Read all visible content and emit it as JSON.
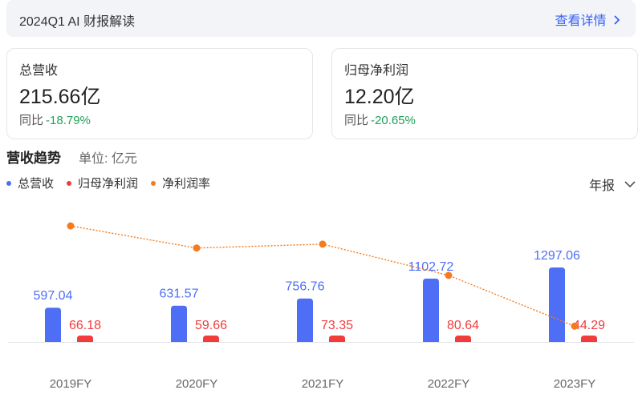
{
  "header": {
    "title": "2024Q1 AI 财报解读",
    "more_label": "查看详情",
    "more_icon": "chevron-right-icon"
  },
  "cards": [
    {
      "label": "总营收",
      "value": "215.66亿",
      "yoy_label": "同比",
      "yoy_value": "-18.79%"
    },
    {
      "label": "归母净利润",
      "value": "12.20亿",
      "yoy_label": "同比",
      "yoy_value": "-20.65%"
    }
  ],
  "section": {
    "title": "营收趋势",
    "unit": "单位: 亿元"
  },
  "period_select": {
    "value": "年报",
    "icon": "chevron-down-icon"
  },
  "colors": {
    "revenue": "#4d6ef5",
    "net_profit": "#f23b3b",
    "margin": "#f47b1e",
    "positive_change": "#22a15a",
    "link": "#3b63f5"
  },
  "chart_data": {
    "type": "bar",
    "categories": [
      "2019FY",
      "2020FY",
      "2021FY",
      "2022FY",
      "2023FY"
    ],
    "series": [
      {
        "name": "总营收",
        "type": "bar",
        "values": [
          597.04,
          631.57,
          756.76,
          1102.72,
          1297.06
        ]
      },
      {
        "name": "归母净利润",
        "type": "bar",
        "values": [
          66.18,
          59.66,
          73.35,
          80.64,
          44.29
        ]
      },
      {
        "name": "净利润率",
        "type": "line",
        "style": "dotted",
        "values": [
          11.1,
          9.4,
          9.7,
          7.3,
          3.4
        ]
      }
    ],
    "legend_position": "top-left",
    "grid": false
  }
}
